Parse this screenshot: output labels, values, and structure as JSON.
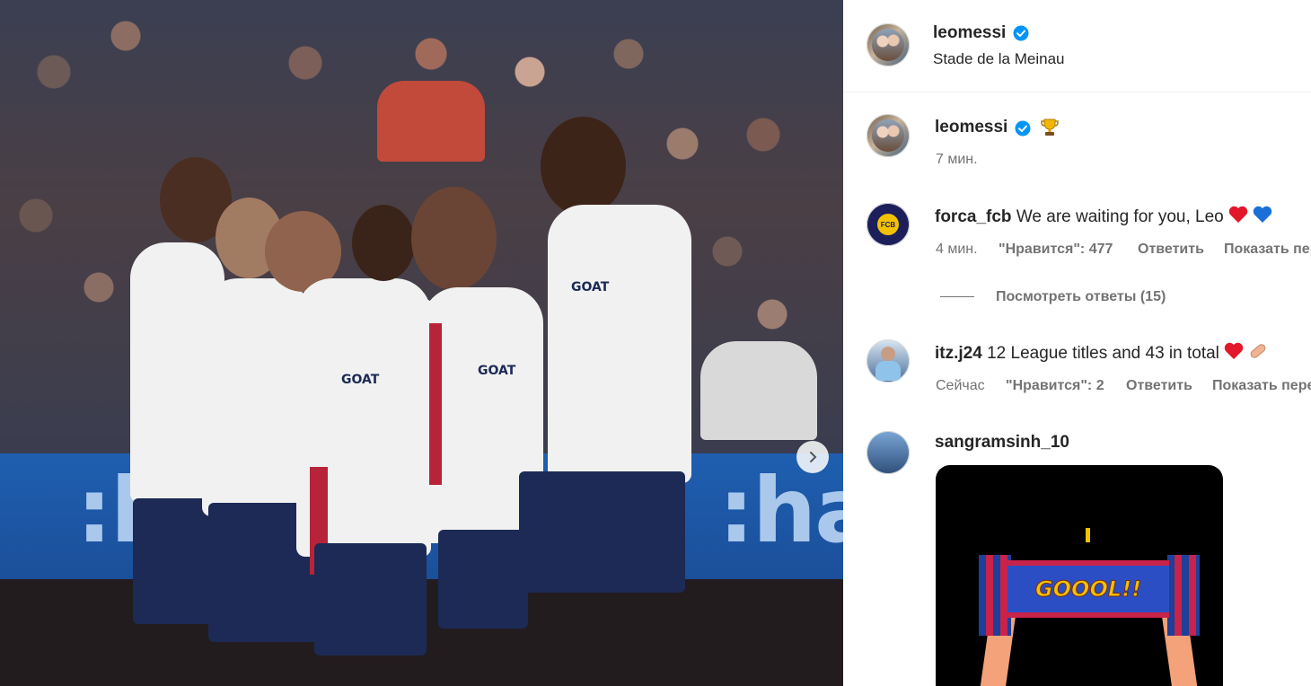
{
  "post": {
    "author": "leomessi",
    "location": "Stade de la Meinau",
    "image_alt_sponsor": "GOAT",
    "board_text": ":ha",
    "left_board_text": ":h"
  },
  "caption": {
    "author": "leomessi",
    "time": "7 мин."
  },
  "comments": [
    {
      "author": "forca_fcb",
      "text": "We are waiting for you, Leo",
      "time": "4 мин.",
      "likes": "\"Нравится\": 477",
      "reply": "Ответить",
      "translate": "Показать перевод",
      "view_replies": "Посмотреть ответы (15)",
      "avatar_label": "FCB"
    },
    {
      "author": "itz.j24",
      "text": "12 League titles and 43 in total",
      "time": "Сейчас",
      "likes": "\"Нравится\": 2",
      "reply": "Ответить",
      "translate": "Показать перевод"
    },
    {
      "author": "sangramsinh_10",
      "gif_text": "GOOOL!!"
    }
  ],
  "colors": {
    "verified": "#0095f6",
    "text": "#262626",
    "muted": "#737373"
  },
  "icons": {
    "verified": "verified-badge-icon",
    "trophy": "trophy-icon",
    "next": "chevron-right-icon"
  }
}
